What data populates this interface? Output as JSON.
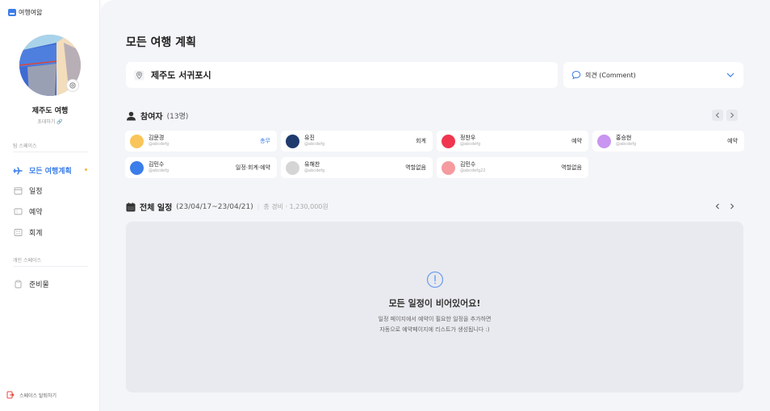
{
  "app": {
    "logo_text": "여행여앓"
  },
  "sidebar": {
    "space_name": "제주도 여행",
    "invite_label": "초대하기 🔗",
    "team_section_label": "팀 스페이스",
    "team_items": [
      {
        "label": "모든 여행계획",
        "icon": "airplane-icon",
        "active": true
      },
      {
        "label": "일정",
        "icon": "calendar-icon"
      },
      {
        "label": "예약",
        "icon": "ticket-icon"
      },
      {
        "label": "회계",
        "icon": "calculator-icon"
      }
    ],
    "personal_section_label": "개인 스페이스",
    "personal_items": [
      {
        "label": "준비물",
        "icon": "clipboard-icon"
      }
    ],
    "leave_label": "스페이스 탈퇴하기"
  },
  "main": {
    "title": "모든 여행 계획",
    "location": "제주도 서귀포시",
    "comment_label": "의견 (Comment)",
    "participants": {
      "title": "참여자",
      "count": "(13명)",
      "people": [
        {
          "name": "김문경",
          "handle": "@abcdefg",
          "role": "총무",
          "color": "#f9c55a",
          "role_blue": true
        },
        {
          "name": "유진",
          "handle": "@abcdefg",
          "role": "회계",
          "color": "#1f3b6e"
        },
        {
          "name": "정찬우",
          "handle": "@abcdefg",
          "role": "예약",
          "color": "#f0364f"
        },
        {
          "name": "홍승현",
          "handle": "@abcdefg",
          "role": "예약",
          "color": "#c895f0"
        },
        {
          "name": "김민수",
          "handle": "@abcdefg",
          "role": "일정·회계·예약",
          "color": "#3b7de9"
        },
        {
          "name": "유해찬",
          "handle": "@abcdefg",
          "role": "역할없음",
          "color": "#d5d5d5"
        },
        {
          "name": "김민수",
          "handle": "@abcdefg22",
          "role": "역할없음",
          "color": "#f59ba0"
        }
      ]
    },
    "schedule": {
      "title": "전체 일정",
      "range": "(23/04/17~23/04/21)",
      "total": "총 경비 · 1,230,000원",
      "empty_title": "모든 일정이 비어있어요!",
      "empty_desc_1": "일정 페이지에서 예약이 필요한 일정을 추가하면",
      "empty_desc_2": "자동으로 예약페이지에 리스트가 생성됩니다 :)"
    }
  },
  "colors": {
    "accent": "#3b7de9",
    "background": "#f4f5f8"
  }
}
